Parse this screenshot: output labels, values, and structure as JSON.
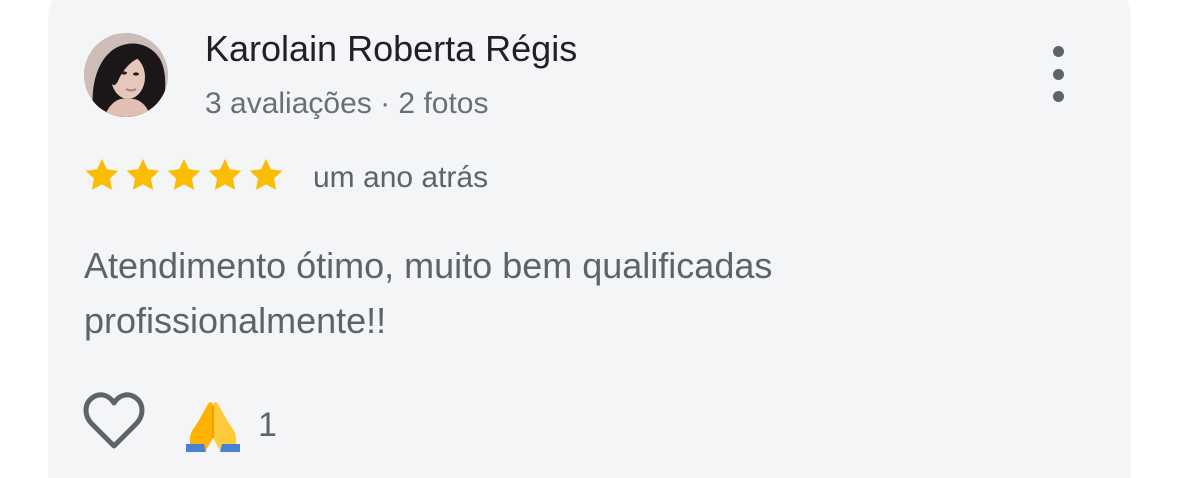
{
  "review": {
    "author_name": "Karolain Roberta Régis",
    "author_meta": "3 avaliações · 2 fotos",
    "rating": 5,
    "rating_max": 5,
    "time_ago": "um ano atrás",
    "text": "Atendimento ótimo, muito bem qualificadas profissionalmente!!",
    "reaction_count": "1"
  },
  "icons": {
    "menu": "more-vertical-icon",
    "like": "heart-outline-icon",
    "reaction": "folded-hands-emoji-icon",
    "star": "star-icon"
  },
  "colors": {
    "card_background": "#f4f5f7",
    "star": "#fbbc04",
    "name_text": "#202124",
    "secondary_text": "#5f6368"
  }
}
